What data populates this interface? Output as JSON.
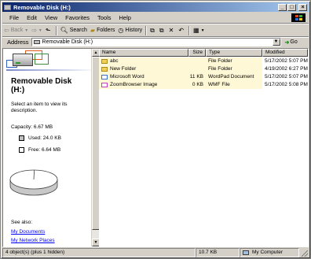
{
  "window": {
    "title": "Removable Disk (H:)",
    "controls": {
      "minimize": "_",
      "maximize": "□",
      "close": "×"
    }
  },
  "menu": [
    "File",
    "Edit",
    "View",
    "Favorites",
    "Tools",
    "Help"
  ],
  "toolbar": {
    "back": "Back",
    "search": "Search",
    "folders": "Folders",
    "history": "History"
  },
  "address": {
    "label": "Address",
    "value": "Removable Disk (H:)",
    "go": "Go"
  },
  "details": {
    "title_line1": "Removable Disk",
    "title_line2": "(H:)",
    "hint": "Select an item to view its description.",
    "capacity": "Capacity: 6.67 MB",
    "used": "Used: 24.0 KB",
    "free": "Free: 6.64 MB",
    "used_fraction": 0.0035,
    "see_also": "See also:",
    "links": [
      "My Documents",
      "My Network Places"
    ]
  },
  "columns": [
    "Name",
    "Size",
    "Type",
    "Modified"
  ],
  "files": [
    {
      "name": "abc",
      "size": "",
      "type": "File Folder",
      "modified": "5/17/2002 5:07 PM",
      "icon": "folder-icon"
    },
    {
      "name": "New Folder",
      "size": "",
      "type": "File Folder",
      "modified": "4/19/2002 6:27 PM",
      "icon": "folder-icon"
    },
    {
      "name": "Microsoft Word",
      "size": "11 KB",
      "type": "WordPad Document",
      "modified": "5/17/2002 5:07 PM",
      "icon": "document-icon"
    },
    {
      "name": "ZoomBrowser Image",
      "size": "0 KB",
      "type": "WMF File",
      "modified": "5/17/2002 5:08 PM",
      "icon": "image-file-icon"
    }
  ],
  "status": {
    "objects": "4 object(s) (plus 1 hidden)",
    "size": "10.7 KB",
    "zone": "My Computer"
  },
  "colors": {
    "titlebar_start": "#0a246a",
    "titlebar_end": "#a6caf0",
    "highlight": "#fff8d6",
    "link": "#0000ee"
  }
}
